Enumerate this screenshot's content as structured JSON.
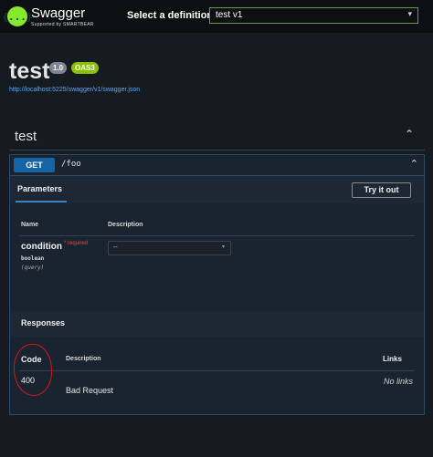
{
  "header": {
    "logo_glyph": "{...}",
    "brand": "Swagger",
    "brand_sub": "Supported by SMARTBEAR",
    "select_label": "Select a definition",
    "definition_value": "test v1"
  },
  "info": {
    "title": "test",
    "version": "1.0",
    "oas": "OAS3",
    "url": "http://localhost:5225/swagger/v1/swagger.json"
  },
  "tag": {
    "name": "test",
    "chevron": "⌃"
  },
  "operation": {
    "method": "GET",
    "path": "/foo",
    "chevron": "⌃",
    "parameters_tab": "Parameters",
    "try_label": "Try it out",
    "col_name": "Name",
    "col_description": "Description",
    "param": {
      "name": "condition",
      "required_marker": "* required",
      "type": "boolean",
      "location": "(query)",
      "select_value": "--"
    },
    "responses_title": "Responses",
    "resp_col_code": "Code",
    "resp_col_description": "Description",
    "resp_col_links": "Links",
    "responses": [
      {
        "code": "400",
        "description": "Bad Request",
        "links": "No links"
      }
    ]
  },
  "colors": {
    "accent_green": "#85ea2d",
    "get_blue": "#1565a6",
    "annotation_red": "#d01a1a"
  }
}
